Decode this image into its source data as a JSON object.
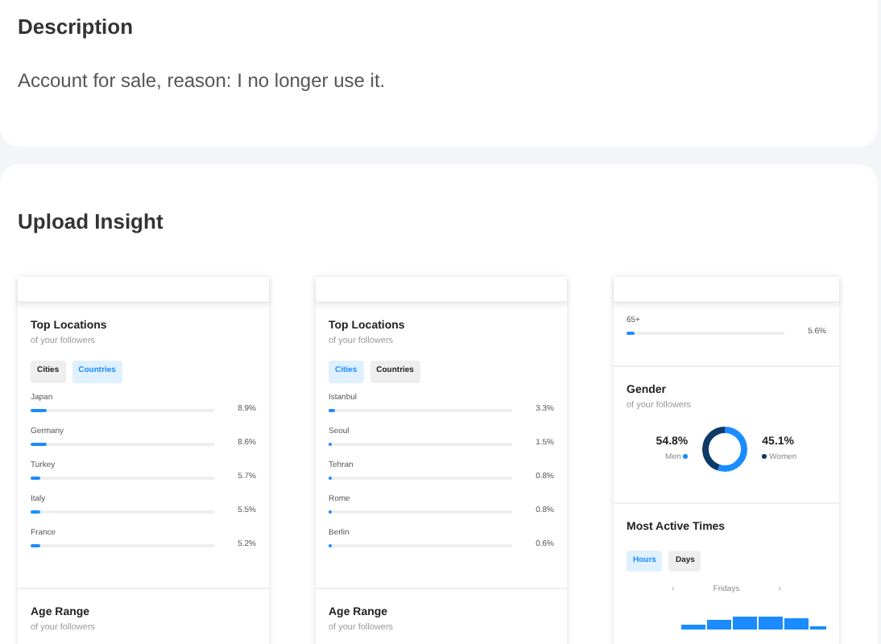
{
  "description": {
    "title": "Description",
    "text": "Account for sale, reason: I no longer use it."
  },
  "insight": {
    "title": "Upload Insight",
    "screenshots": [
      {
        "sections": [
          {
            "kind": "locations",
            "title": "Top Locations",
            "subtitle": "of your followers",
            "tabs": [
              {
                "label": "Cities",
                "selected": false
              },
              {
                "label": "Countries",
                "selected": true
              }
            ],
            "rows": [
              {
                "label": "Japan",
                "level": 0.089,
                "value": "8.9%"
              },
              {
                "label": "Germany",
                "level": 0.086,
                "value": "8.6%"
              },
              {
                "label": "Turkey",
                "level": 0.057,
                "value": "5.7%"
              },
              {
                "label": "Italy",
                "level": 0.055,
                "value": "5.5%"
              },
              {
                "label": "France",
                "level": 0.052,
                "value": "5.2%"
              }
            ]
          },
          {
            "kind": "heading",
            "title": "Age Range",
            "subtitle": "of your followers"
          }
        ]
      },
      {
        "sections": [
          {
            "kind": "locations",
            "title": "Top Locations",
            "subtitle": "of your followers",
            "tabs": [
              {
                "label": "Cities",
                "selected": true
              },
              {
                "label": "Countries",
                "selected": false
              }
            ],
            "rows": [
              {
                "label": "Istanbul",
                "level": 0.033,
                "value": "3.3%"
              },
              {
                "label": "Seoul",
                "level": 0.015,
                "value": "1.5%"
              },
              {
                "label": "Tehran",
                "level": 0.008,
                "value": "0.8%"
              },
              {
                "label": "Rome",
                "level": 0.008,
                "value": "0.8%"
              },
              {
                "label": "Berlin",
                "level": 0.006,
                "value": "0.6%"
              }
            ]
          },
          {
            "kind": "heading",
            "title": "Age Range",
            "subtitle": "of your followers"
          }
        ]
      },
      {
        "sections": [
          {
            "kind": "bars",
            "rows": [
              {
                "label": "65+",
                "level": 0.056,
                "value": "5.6%"
              }
            ]
          },
          {
            "kind": "gender",
            "title": "Gender",
            "subtitle": "of your followers",
            "items": [
              {
                "value": "54.8%",
                "label": "Men",
                "color": "#1a8cff",
                "level": 0.548
              },
              {
                "value": "45.1%",
                "label": "Women",
                "color": "#0d3a66",
                "level": 0.451
              }
            ]
          },
          {
            "kind": "active",
            "title": "Most Active Times",
            "tabs": [
              {
                "label": "Hours",
                "selected": true
              },
              {
                "label": "Days",
                "selected": false
              }
            ],
            "prev": "‹",
            "day": "Fridays",
            "next": "›"
          }
        ]
      }
    ]
  }
}
